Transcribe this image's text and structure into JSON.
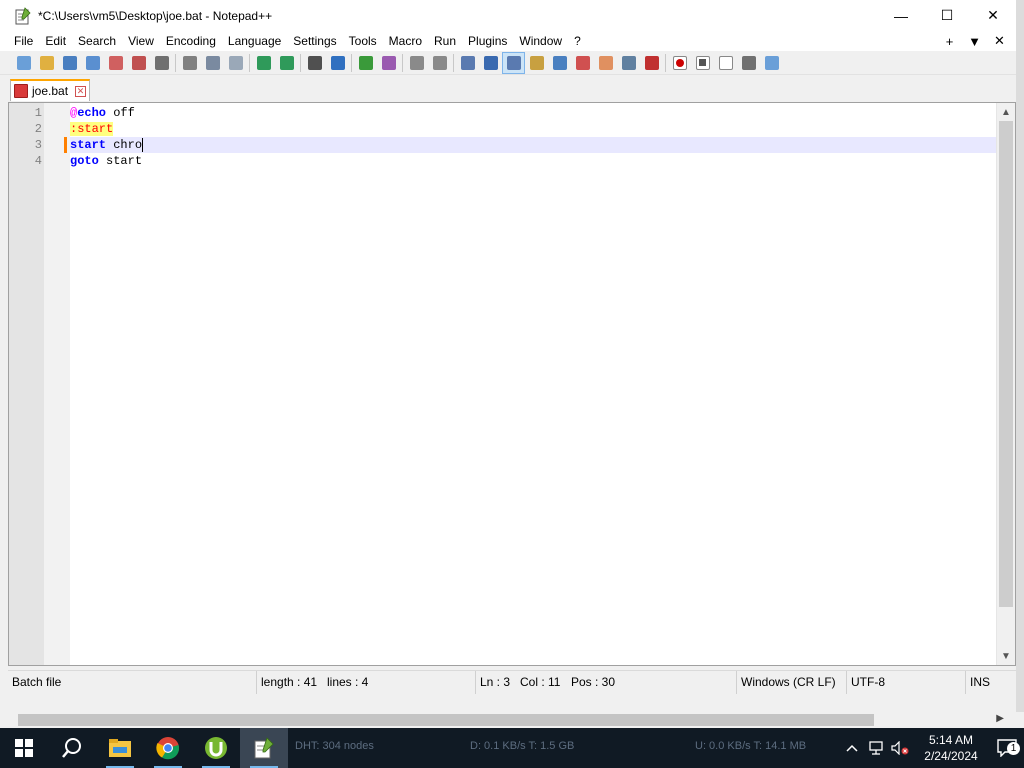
{
  "window": {
    "title": "*C:\\Users\\vm5\\Desktop\\joe.bat - Notepad++",
    "minimize_glyph": "—",
    "maximize_glyph": "☐",
    "close_glyph": "✕"
  },
  "menu": {
    "items": [
      "File",
      "Edit",
      "Search",
      "View",
      "Encoding",
      "Language",
      "Settings",
      "Tools",
      "Macro",
      "Run",
      "Plugins",
      "Window",
      "?"
    ],
    "right_buttons": [
      "+",
      "▼",
      "✕"
    ]
  },
  "toolbar": {
    "icons": [
      "new-file-icon",
      "open-file-icon",
      "save-icon",
      "save-all-icon",
      "close-icon",
      "close-all-icon",
      "print-icon",
      "|",
      "cut-icon",
      "copy-icon",
      "paste-icon",
      "|",
      "undo-icon",
      "redo-icon",
      "|",
      "find-icon",
      "replace-icon",
      "|",
      "zoom-in-icon",
      "zoom-out-icon",
      "|",
      "sync-vertical-icon",
      "sync-horizontal-icon",
      "|",
      "word-wrap-icon",
      "show-all-chars-icon",
      "indent-guide-icon",
      "user-language-icon",
      "doc-map-icon",
      "doc-list-icon",
      "function-list-icon",
      "folder-workspace-icon",
      "monitoring-icon",
      "|",
      "record-macro-icon",
      "stop-record-icon",
      "play-macro-icon",
      "run-macro-multiple-icon",
      "save-macro-icon"
    ],
    "active_icon": "indent-guide-icon"
  },
  "tab": {
    "label": "joe.bat",
    "close_glyph": "✕"
  },
  "editor": {
    "current_line": 3,
    "lines": [
      {
        "num": "1",
        "tokens": [
          {
            "t": "@",
            "c": "at"
          },
          {
            "t": "echo",
            "c": "kw"
          },
          {
            "t": " off",
            "c": "plain"
          }
        ]
      },
      {
        "num": "2",
        "tokens": [
          {
            "t": ":start",
            "c": "label"
          }
        ]
      },
      {
        "num": "3",
        "tokens": [
          {
            "t": "start",
            "c": "kw"
          },
          {
            "t": " chro",
            "c": "plain"
          }
        ]
      },
      {
        "num": "4",
        "tokens": [
          {
            "t": "goto",
            "c": "kw"
          },
          {
            "t": " start",
            "c": "plain"
          }
        ]
      }
    ]
  },
  "statusbar": {
    "file_type": "Batch file",
    "length": "length : 41",
    "lines": "lines : 4",
    "ln": "Ln : 3",
    "col": "Col : 11",
    "pos": "Pos : 30",
    "eol": "Windows (CR LF)",
    "encoding": "UTF-8",
    "mode": "INS"
  },
  "taskbar": {
    "apps": [
      "windows-start-icon",
      "search-icon",
      "file-explorer-icon",
      "chrome-icon",
      "utorrent-icon",
      "notepadpp-icon"
    ],
    "active_app": "notepadpp-icon",
    "info_dht": "DHT: 304 nodes",
    "info_down": "D: 0.1 KB/s T: 1.5 GB",
    "info_up": "U: 0.0 KB/s T: 14.1 MB",
    "time": "5:14 AM",
    "date": "2/24/2024",
    "notification_count": "1"
  },
  "colors": {
    "accent_tab": "#ffa500",
    "caret_line": "#e8e8ff",
    "keyword": "#0000ff",
    "label_bg": "#ffff80",
    "label_fg": "#ff0000",
    "at_symbol": "#ff00ff"
  }
}
